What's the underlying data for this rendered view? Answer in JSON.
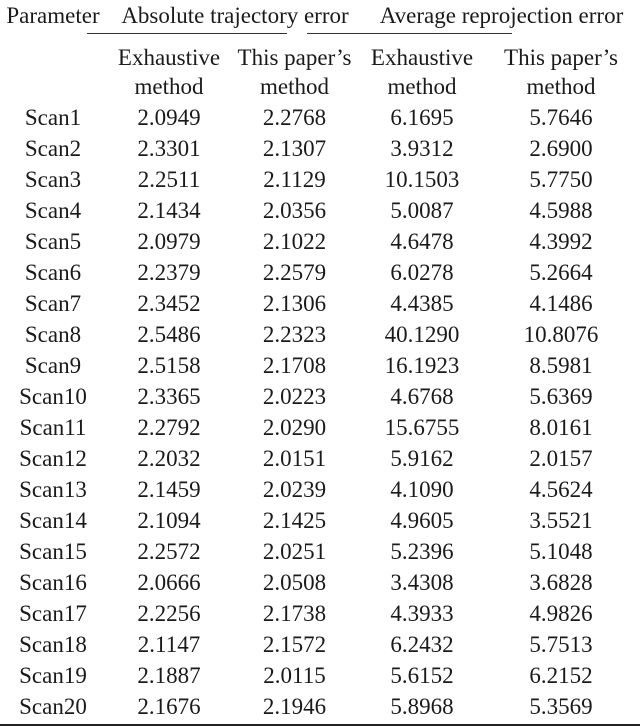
{
  "table": {
    "header": {
      "parameter": "Parameter",
      "groups": [
        "Absolute trajectory error",
        "Average reprojection error"
      ],
      "subcolumns": [
        [
          "Exhaustive",
          "method"
        ],
        [
          "This paper’s",
          "method"
        ],
        [
          "Exhaustive",
          "method"
        ],
        [
          "This paper’s",
          "method"
        ]
      ]
    },
    "rows": [
      [
        "Scan1",
        "2.0949",
        "2.2768",
        "6.1695",
        "5.7646"
      ],
      [
        "Scan2",
        "2.3301",
        "2.1307",
        "3.9312",
        "2.6900"
      ],
      [
        "Scan3",
        "2.2511",
        "2.1129",
        "10.1503",
        "5.7750"
      ],
      [
        "Scan4",
        "2.1434",
        "2.0356",
        "5.0087",
        "4.5988"
      ],
      [
        "Scan5",
        "2.0979",
        "2.1022",
        "4.6478",
        "4.3992"
      ],
      [
        "Scan6",
        "2.2379",
        "2.2579",
        "6.0278",
        "5.2664"
      ],
      [
        "Scan7",
        "2.3452",
        "2.1306",
        "4.4385",
        "4.1486"
      ],
      [
        "Scan8",
        "2.5486",
        "2.2323",
        "40.1290",
        "10.8076"
      ],
      [
        "Scan9",
        "2.5158",
        "2.1708",
        "16.1923",
        "8.5981"
      ],
      [
        "Scan10",
        "2.3365",
        "2.0223",
        "4.6768",
        "5.6369"
      ],
      [
        "Scan11",
        "2.2792",
        "2.0290",
        "15.6755",
        "8.0161"
      ],
      [
        "Scan12",
        "2.2032",
        "2.0151",
        "5.9162",
        "2.0157"
      ],
      [
        "Scan13",
        "2.1459",
        "2.0239",
        "4.1090",
        "4.5624"
      ],
      [
        "Scan14",
        "2.1094",
        "2.1425",
        "4.9605",
        "3.5521"
      ],
      [
        "Scan15",
        "2.2572",
        "2.0251",
        "5.2396",
        "5.1048"
      ],
      [
        "Scan16",
        "2.0666",
        "2.0508",
        "3.4308",
        "3.6828"
      ],
      [
        "Scan17",
        "2.2256",
        "2.1738",
        "4.3933",
        "4.9826"
      ],
      [
        "Scan18",
        "2.1147",
        "2.1572",
        "6.2432",
        "5.7513"
      ],
      [
        "Scan19",
        "2.1887",
        "2.0115",
        "5.6152",
        "6.2152"
      ],
      [
        "Scan20",
        "2.1676",
        "2.1946",
        "5.8968",
        "5.3569"
      ]
    ]
  }
}
